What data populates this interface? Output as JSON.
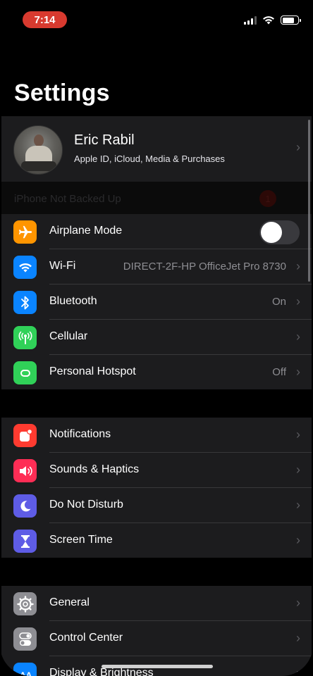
{
  "status_bar": {
    "time": "7:14"
  },
  "title": "Settings",
  "profile": {
    "name": "Eric Rabil",
    "subtitle": "Apple ID, iCloud, Media & Purchases"
  },
  "backup_banner": {
    "text": "iPhone Not Backed Up",
    "badge": "1"
  },
  "groups": [
    {
      "items": [
        {
          "label": "Airplane Mode",
          "icon": "airplane-icon",
          "color": "#ff9500",
          "toggle": false
        },
        {
          "label": "Wi-Fi",
          "icon": "wifi-icon",
          "color": "#0a84ff",
          "value": "DIRECT-2F-HP OfficeJet Pro 8730"
        },
        {
          "label": "Bluetooth",
          "icon": "bluetooth-icon",
          "color": "#0a84ff",
          "value": "On"
        },
        {
          "label": "Cellular",
          "icon": "cellular-antenna-icon",
          "color": "#30d158",
          "value": ""
        },
        {
          "label": "Personal Hotspot",
          "icon": "hotspot-link-icon",
          "color": "#30d158",
          "value": "Off"
        }
      ]
    },
    {
      "items": [
        {
          "label": "Notifications",
          "icon": "notifications-icon",
          "color": "#ff3b30"
        },
        {
          "label": "Sounds & Haptics",
          "icon": "speaker-icon",
          "color": "#ff2d55"
        },
        {
          "label": "Do Not Disturb",
          "icon": "moon-icon",
          "color": "#5e5ce6"
        },
        {
          "label": "Screen Time",
          "icon": "hourglass-icon",
          "color": "#5e5ce6"
        }
      ]
    },
    {
      "items": [
        {
          "label": "General",
          "icon": "gear-icon",
          "color": "#8e8e93"
        },
        {
          "label": "Control Center",
          "icon": "toggles-icon",
          "color": "#8e8e93"
        },
        {
          "label": "Display & Brightness",
          "icon": "display-icon",
          "color": "#0a84ff"
        }
      ]
    }
  ],
  "chevron_glyph": "›"
}
